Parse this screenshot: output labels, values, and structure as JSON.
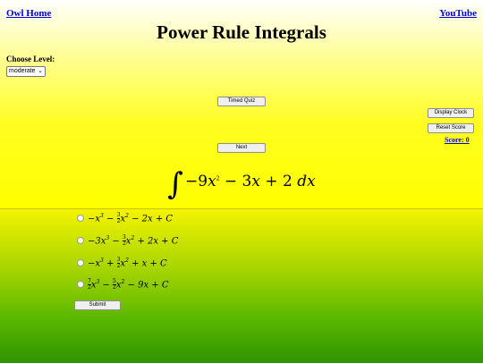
{
  "nav": {
    "home": "Owl Home",
    "youtube": "YouTube"
  },
  "title": "Power Rule Integrals",
  "level": {
    "label": "Choose Level:",
    "selected": "moderate"
  },
  "buttons": {
    "timed_quiz": "Timed Quiz",
    "next": "Next",
    "display_clock": "Display Clock",
    "reset_score": "Reset Score",
    "submit": "Submit"
  },
  "score": "Score: 0",
  "problem": {
    "sign": "∫",
    "coef1": "−9",
    "var1": "x",
    "exp1": "2",
    "mid": " − 3",
    "var2": "x",
    "tail": " + 2 ",
    "dx": "dx"
  },
  "choices": [
    {
      "a": "−x",
      "a_exp": "3",
      "b_sign": " − ",
      "b_num": "3",
      "b_den": "2",
      "b_var": "x",
      "b_exp": "2",
      "c": " − 2x + C"
    },
    {
      "a": "−3x",
      "a_exp": "3",
      "b_sign": " − ",
      "b_num": "3",
      "b_den": "2",
      "b_var": "x",
      "b_exp": "2",
      "c": " + 2x + C"
    },
    {
      "a": "−x",
      "a_exp": "3",
      "b_sign": " + ",
      "b_num": "3",
      "b_den": "2",
      "b_var": "x",
      "b_exp": "2",
      "c": " + x + C"
    },
    {
      "a_num": "7",
      "a_den": "2",
      "a": "x",
      "a_exp": "3",
      "b_sign": " − ",
      "b_num": "5",
      "b_den": "2",
      "b_var": "x",
      "b_exp": "2",
      "c": " − 9x + C"
    }
  ]
}
